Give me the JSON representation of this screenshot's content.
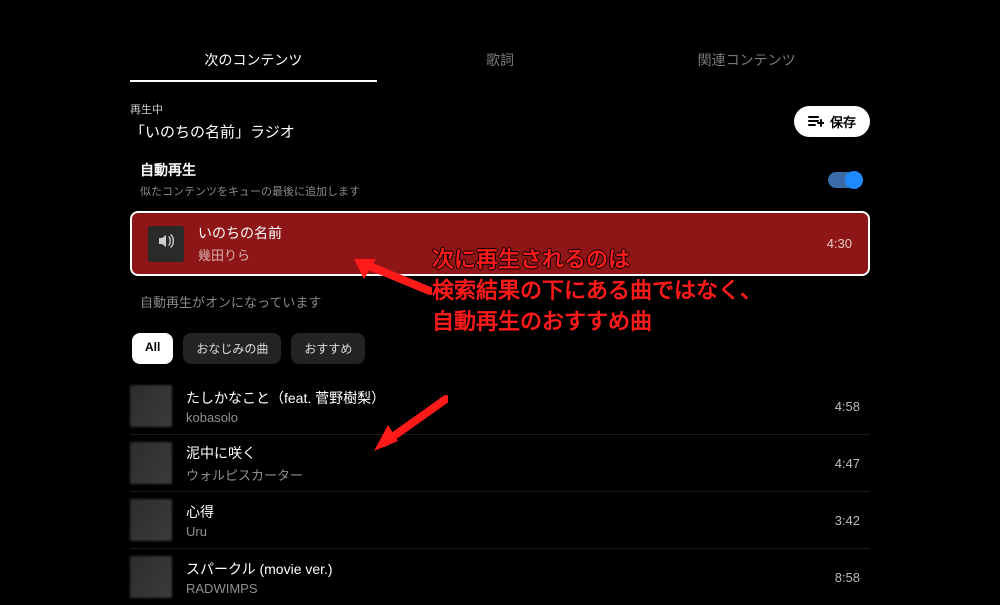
{
  "tabs": {
    "next": "次のコンテンツ",
    "lyrics": "歌詞",
    "related": "関連コンテンツ"
  },
  "nowPlaying": {
    "label": "再生中",
    "title": "「いのちの名前」ラジオ"
  },
  "save": {
    "label": "保存"
  },
  "autoplay": {
    "title": "自動再生",
    "sub": "似たコンテンツをキューの最後に追加します",
    "on": true,
    "note": "自動再生がオンになっています"
  },
  "nextTrack": {
    "title": "いのちの名前",
    "artist": "幾田りら",
    "duration": "4:30"
  },
  "chips": {
    "all": "All",
    "familiar": "おなじみの曲",
    "recommend": "おすすめ"
  },
  "tracks": [
    {
      "title": "たしかなこと（feat. 菅野樹梨）",
      "artist": "kobasolo",
      "duration": "4:58"
    },
    {
      "title": "泥中に咲く",
      "artist": "ウォルピスカーター",
      "duration": "4:47"
    },
    {
      "title": "心得",
      "artist": "Uru",
      "duration": "3:42"
    },
    {
      "title": "スパークル (movie ver.)",
      "artist": "RADWIMPS",
      "duration": "8:58"
    }
  ],
  "annotation": {
    "line1": "次に再生されるのは",
    "line2": "検索結果の下にある曲ではなく、",
    "line3": "自動再生のおすすめ曲"
  }
}
